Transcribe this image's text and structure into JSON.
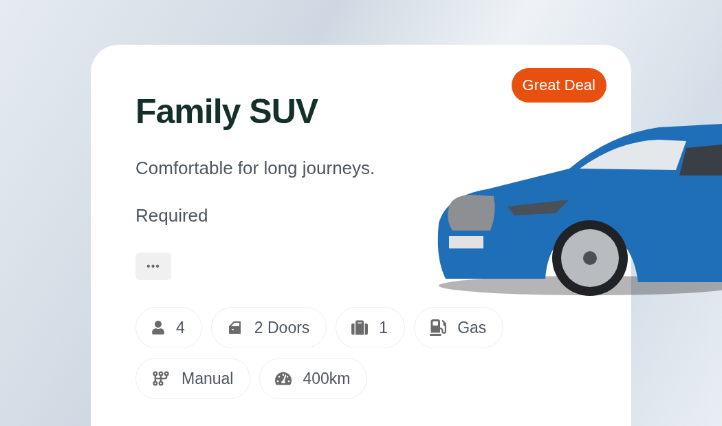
{
  "card": {
    "title": "Family SUV",
    "badge": "Great Deal",
    "description": "Comfortable for long journeys.",
    "requirement": "Required",
    "more_button": "•••",
    "features": [
      {
        "kind": "seats",
        "label": "4"
      },
      {
        "kind": "doors",
        "label": "2 Doors"
      },
      {
        "kind": "luggage",
        "label": "1"
      },
      {
        "kind": "fuel",
        "label": "Gas"
      },
      {
        "kind": "transmission",
        "label": "Manual"
      },
      {
        "kind": "range",
        "label": "400km"
      }
    ]
  }
}
